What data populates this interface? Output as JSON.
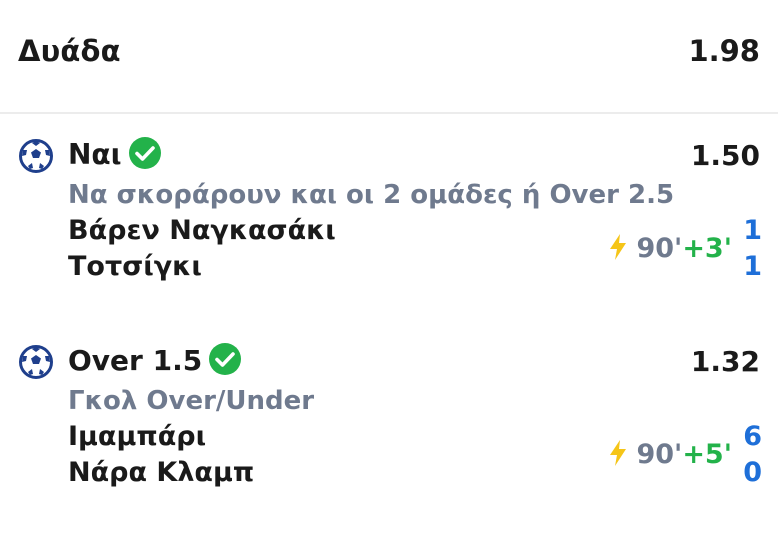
{
  "header": {
    "title": "Δυάδα",
    "total_odds": "1.98"
  },
  "colors": {
    "market_text": "#6f7a8e",
    "added_time": "#23b24a",
    "score": "#1e6fd8",
    "check": "#23b24a",
    "bolt": "#f5c518"
  },
  "legs": [
    {
      "sport_icon": "soccer-ball-icon",
      "selection": "Ναι",
      "status_icon": "check-circle-icon",
      "odds": "1.50",
      "market": "Να σκοράρουν και οι 2 ομάδες ή Over 2.5",
      "home_team": "Βάρεν Ναγκασάκι",
      "away_team": "Τοτσίγκι",
      "live_icon": "lightning-icon",
      "minute": "90'",
      "added_time": "+3'",
      "home_score": "1",
      "away_score": "1"
    },
    {
      "sport_icon": "soccer-ball-icon",
      "selection": "Over 1.5",
      "status_icon": "check-circle-icon",
      "odds": "1.32",
      "market": "Γκολ Over/Under",
      "home_team": "Ιμαμπάρι",
      "away_team": "Νάρα Κλαμπ",
      "live_icon": "lightning-icon",
      "minute": "90'",
      "added_time": "+5'",
      "home_score": "6",
      "away_score": "0"
    }
  ]
}
